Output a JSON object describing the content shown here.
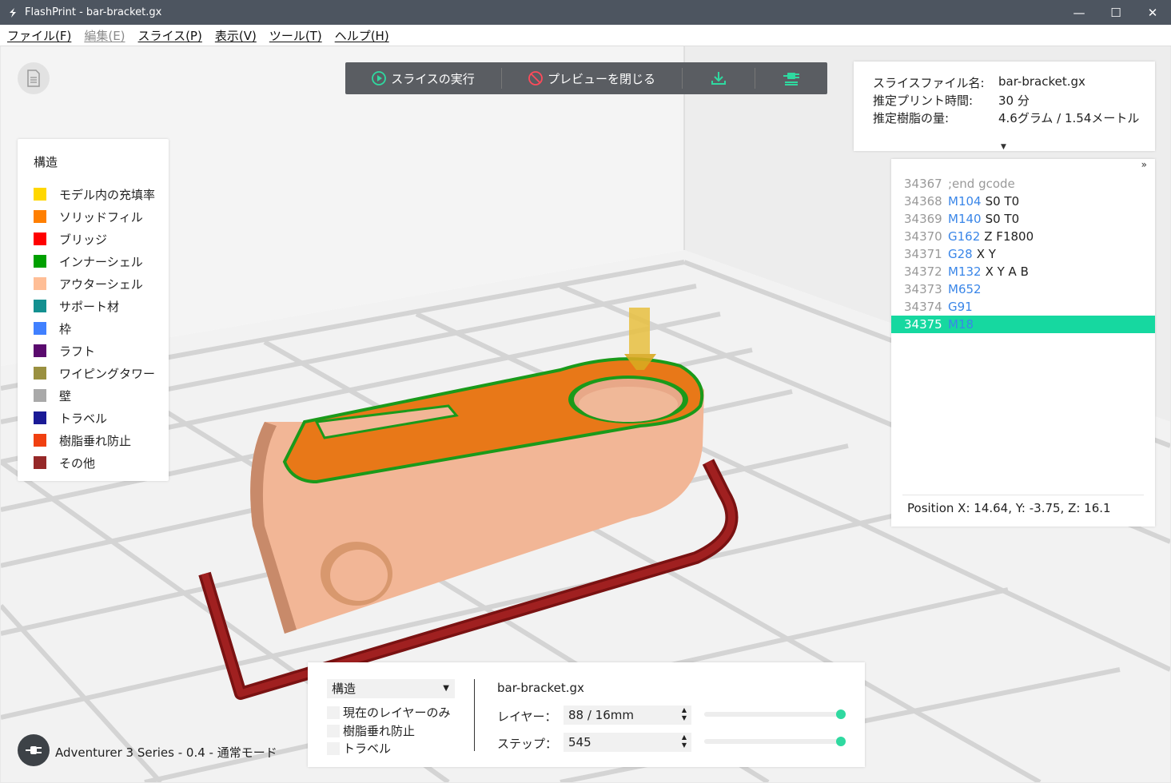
{
  "window": {
    "title": "FlashPrint - bar-bracket.gx",
    "controls": {
      "minimize": "—",
      "maximize": "☐",
      "close": "✕"
    }
  },
  "menu": [
    {
      "label": "ファイル(F)",
      "enabled": true
    },
    {
      "label": "編集(E)",
      "enabled": false
    },
    {
      "label": "スライス(P)",
      "enabled": true
    },
    {
      "label": "表示(V)",
      "enabled": true
    },
    {
      "label": "ツール(T)",
      "enabled": true
    },
    {
      "label": "ヘルプ(H)",
      "enabled": true
    }
  ],
  "toolbar": {
    "slice_label": "スライスの実行",
    "close_preview_label": "プレビューを閉じる",
    "accent": "#2fd9a0"
  },
  "legend": {
    "title": "構造",
    "items": [
      {
        "label": "モデル内の充填率",
        "color": "#ffd700"
      },
      {
        "label": "ソリッドフィル",
        "color": "#ff7f00"
      },
      {
        "label": "ブリッジ",
        "color": "#ff0000"
      },
      {
        "label": "インナーシェル",
        "color": "#00a000"
      },
      {
        "label": "アウターシェル",
        "color": "#ffbe96"
      },
      {
        "label": "サポート材",
        "color": "#139090"
      },
      {
        "label": "枠",
        "color": "#4080ff"
      },
      {
        "label": "ラフト",
        "color": "#5a0a6e"
      },
      {
        "label": "ワイピングタワー",
        "color": "#9a9040"
      },
      {
        "label": "壁",
        "color": "#a9a9a9"
      },
      {
        "label": "トラベル",
        "color": "#1a1a96"
      },
      {
        "label": "樹脂垂れ防止",
        "color": "#f04010"
      },
      {
        "label": "その他",
        "color": "#962828"
      }
    ]
  },
  "info": {
    "rows": [
      {
        "k": "スライスファイル名:",
        "v": "bar-bracket.gx"
      },
      {
        "k": "推定プリント時間:",
        "v": "30 分"
      },
      {
        "k": "推定樹脂の量:",
        "v": "4.6グラム / 1.54メートル"
      }
    ]
  },
  "gcode": {
    "expand": "»",
    "lines": [
      {
        "num": "34367",
        "cmd": "",
        "args": ";end gcode",
        "comment": true
      },
      {
        "num": "34368",
        "cmd": "M104",
        "args": "S0 T0"
      },
      {
        "num": "34369",
        "cmd": "M140",
        "args": "S0 T0"
      },
      {
        "num": "34370",
        "cmd": "G162",
        "args": "Z F1800"
      },
      {
        "num": "34371",
        "cmd": "G28",
        "args": "X Y"
      },
      {
        "num": "34372",
        "cmd": "M132",
        "args": "X Y A B"
      },
      {
        "num": "34373",
        "cmd": "M652",
        "args": ""
      },
      {
        "num": "34374",
        "cmd": "G91",
        "args": ""
      },
      {
        "num": "34375",
        "cmd": "M18",
        "args": "",
        "active": true
      }
    ],
    "position": "Position   X: 14.64, Y: -3.75, Z: 16.1"
  },
  "bottom": {
    "select_value": "構造",
    "checks": [
      "現在のレイヤーのみ",
      "樹脂垂れ防止",
      "トラベル"
    ],
    "file": "bar-bracket.gx",
    "layer_label": "レイヤー：",
    "layer_value": "88 / 16mm",
    "layer_fraction": 1.0,
    "step_label": "ステップ：",
    "step_value": "545",
    "step_fraction": 1.0
  },
  "printer": {
    "label": "Adventurer 3 Series - 0.4 - 通常モード"
  }
}
